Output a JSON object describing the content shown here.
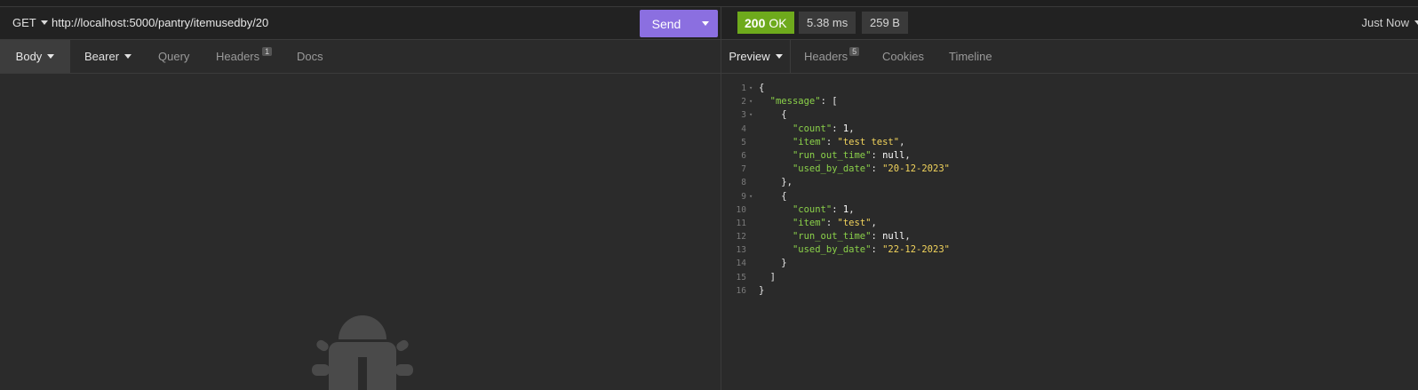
{
  "request": {
    "method": "GET",
    "url": "http://localhost:5000/pantry/itemusedby/20",
    "send_label": "Send"
  },
  "request_tabs": [
    {
      "label": "Body",
      "active": true,
      "dropdown": true
    },
    {
      "label": "Bearer",
      "active": false,
      "dropdown": true
    },
    {
      "label": "Query",
      "active": false
    },
    {
      "label": "Headers",
      "active": false,
      "badge": "1"
    },
    {
      "label": "Docs",
      "active": false
    }
  ],
  "response": {
    "status_code": "200",
    "status_text": "OK",
    "time": "5.38 ms",
    "size": "259 B",
    "history": "Just Now"
  },
  "response_tabs": [
    {
      "label": "Preview",
      "active": true,
      "dropdown": true
    },
    {
      "label": "Headers",
      "active": false,
      "badge": "5"
    },
    {
      "label": "Cookies",
      "active": false
    },
    {
      "label": "Timeline",
      "active": false
    }
  ],
  "code_lines": [
    {
      "n": "1",
      "fold": true,
      "parts": [
        [
          "p",
          "{"
        ]
      ]
    },
    {
      "n": "2",
      "fold": true,
      "parts": [
        [
          "p",
          "  "
        ],
        [
          "k",
          "\"message\""
        ],
        [
          "p",
          ": ["
        ]
      ]
    },
    {
      "n": "3",
      "fold": true,
      "parts": [
        [
          "p",
          "    {"
        ]
      ]
    },
    {
      "n": "4",
      "fold": false,
      "parts": [
        [
          "p",
          "      "
        ],
        [
          "k",
          "\"count\""
        ],
        [
          "p",
          ": "
        ],
        [
          "n",
          "1"
        ],
        [
          "p",
          ","
        ]
      ]
    },
    {
      "n": "5",
      "fold": false,
      "parts": [
        [
          "p",
          "      "
        ],
        [
          "k",
          "\"item\""
        ],
        [
          "p",
          ": "
        ],
        [
          "s",
          "\"test test\""
        ],
        [
          "p",
          ","
        ]
      ]
    },
    {
      "n": "6",
      "fold": false,
      "parts": [
        [
          "p",
          "      "
        ],
        [
          "k",
          "\"run_out_time\""
        ],
        [
          "p",
          ": "
        ],
        [
          "n",
          "null"
        ],
        [
          "p",
          ","
        ]
      ]
    },
    {
      "n": "7",
      "fold": false,
      "parts": [
        [
          "p",
          "      "
        ],
        [
          "k",
          "\"used_by_date\""
        ],
        [
          "p",
          ": "
        ],
        [
          "s",
          "\"20-12-2023\""
        ]
      ]
    },
    {
      "n": "8",
      "fold": false,
      "parts": [
        [
          "p",
          "    },"
        ]
      ]
    },
    {
      "n": "9",
      "fold": true,
      "parts": [
        [
          "p",
          "    {"
        ]
      ]
    },
    {
      "n": "10",
      "fold": false,
      "parts": [
        [
          "p",
          "      "
        ],
        [
          "k",
          "\"count\""
        ],
        [
          "p",
          ": "
        ],
        [
          "n",
          "1"
        ],
        [
          "p",
          ","
        ]
      ]
    },
    {
      "n": "11",
      "fold": false,
      "parts": [
        [
          "p",
          "      "
        ],
        [
          "k",
          "\"item\""
        ],
        [
          "p",
          ": "
        ],
        [
          "s",
          "\"test\""
        ],
        [
          "p",
          ","
        ]
      ]
    },
    {
      "n": "12",
      "fold": false,
      "parts": [
        [
          "p",
          "      "
        ],
        [
          "k",
          "\"run_out_time\""
        ],
        [
          "p",
          ": "
        ],
        [
          "n",
          "null"
        ],
        [
          "p",
          ","
        ]
      ]
    },
    {
      "n": "13",
      "fold": false,
      "parts": [
        [
          "p",
          "      "
        ],
        [
          "k",
          "\"used_by_date\""
        ],
        [
          "p",
          ": "
        ],
        [
          "s",
          "\"22-12-2023\""
        ]
      ]
    },
    {
      "n": "14",
      "fold": false,
      "parts": [
        [
          "p",
          "    }"
        ]
      ]
    },
    {
      "n": "15",
      "fold": false,
      "parts": [
        [
          "p",
          "  ]"
        ]
      ]
    },
    {
      "n": "16",
      "fold": false,
      "parts": [
        [
          "p",
          "}"
        ]
      ]
    }
  ],
  "colors": {
    "send_button": "#8b6fe0",
    "status_ok": "#6eaa1c",
    "json_key": "#8bd14a",
    "json_string": "#f2d45c"
  },
  "icons": [
    "caret-down-icon",
    "bug-icon"
  ]
}
